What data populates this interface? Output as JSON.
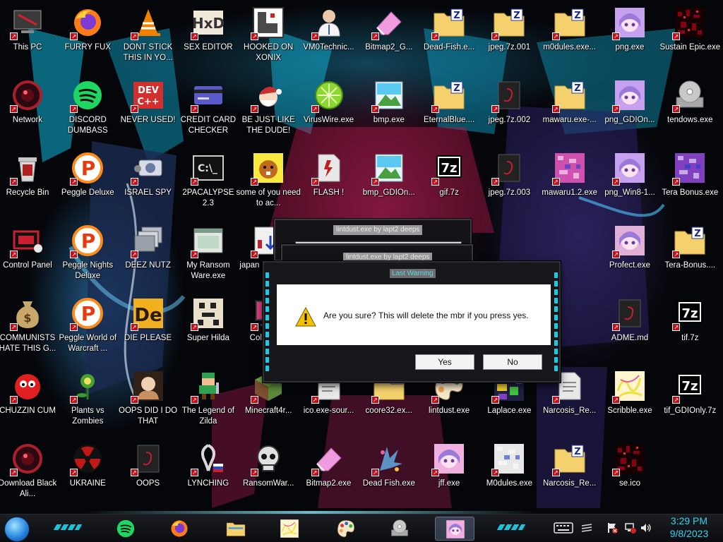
{
  "desktop": {
    "icons": [
      {
        "label": "This PC",
        "icon": "computer-icon",
        "color": "#3a3a3a"
      },
      {
        "label": "FURRY FUX",
        "icon": "firefox-icon",
        "color": "#ff7b16"
      },
      {
        "label": "DONT STICK THIS IN YO...",
        "icon": "vlc-cone-icon",
        "color": "#f08000"
      },
      {
        "label": "SEX EDITOR",
        "icon": "hxd-editor-icon",
        "color": "#f0e8d8"
      },
      {
        "label": "HOOKED ON XONIX",
        "icon": "xonix-game-icon",
        "color": "#4a4a4a"
      },
      {
        "label": "VM0Technic...",
        "icon": "doctor-person-icon",
        "color": "#e8c8a8"
      },
      {
        "label": "Bitmap2_G...",
        "icon": "eraser-icon",
        "color": "#f09ae0"
      },
      {
        "label": "Dead-Fish.e...",
        "icon": "zip-folder-icon",
        "color": "#f5d16e"
      },
      {
        "label": "jpeg.7z.001",
        "icon": "zip-folder-icon",
        "color": "#f5d16e"
      },
      {
        "label": "m0dules.exe...",
        "icon": "zip-folder-icon",
        "color": "#f5d16e"
      },
      {
        "label": "png.exe",
        "icon": "anime-girl-icon",
        "color": "#c8a0f0"
      },
      {
        "label": "Sustain Epic.exe",
        "icon": "noise-red-icon",
        "color": "#8a0010"
      },
      {
        "label": "Network",
        "icon": "network-orb-icon",
        "color": "#aa1e2e"
      },
      {
        "label": "DISCORD DUMBASS",
        "icon": "spotify-icon",
        "color": "#1ed760"
      },
      {
        "label": "NEVER USED!",
        "icon": "devcpp-icon",
        "color": "#d32f2f"
      },
      {
        "label": "CREDIT CARD CHECKER",
        "icon": "credit-card-icon",
        "color": "#5a5ac8"
      },
      {
        "label": "BE JUST LIKE THE DUDE!",
        "icon": "santa-icon",
        "color": "#c83030"
      },
      {
        "label": "VirusWire.exe",
        "icon": "lime-icon",
        "color": "#8ad830"
      },
      {
        "label": "bmp.exe",
        "icon": "image-file-icon",
        "color": "#5ac8f0"
      },
      {
        "label": "EternalBlue....",
        "icon": "zip-folder-icon",
        "color": "#f5d16e"
      },
      {
        "label": "jpeg.7z.002",
        "icon": "dark-file-icon",
        "color": "#222222"
      },
      {
        "label": "mawaru.exe-...",
        "icon": "zip-folder-icon",
        "color": "#f5d16e"
      },
      {
        "label": "png_GDIOn...",
        "icon": "anime-girl-icon",
        "color": "#c8a0f0"
      },
      {
        "label": "tendows.exe",
        "icon": "cd-drive-icon",
        "color": "#c8c8c8"
      },
      {
        "label": "Recycle Bin",
        "icon": "recycle-bin-icon",
        "color": "#b02020"
      },
      {
        "label": "Peggle Deluxe",
        "icon": "peggle-icon",
        "color": "#ff8c1a"
      },
      {
        "label": "ISRAEL SPY",
        "icon": "camera-icon",
        "color": "#d8dce8"
      },
      {
        "label": "2PACALYPSE 2.3",
        "icon": "terminal-icon",
        "color": "#111111"
      },
      {
        "label": "some of you need to ac...",
        "icon": "dog-icon",
        "color": "#c06a1e"
      },
      {
        "label": "FLASH !",
        "icon": "flash-file-icon",
        "color": "#e8e8e8"
      },
      {
        "label": "bmp_GDIOn...",
        "icon": "image-file-icon",
        "color": "#5ac8f0"
      },
      {
        "label": "gif.7z",
        "icon": "7z-icon",
        "color": "#ffffff"
      },
      {
        "label": "jpeg.7z.003",
        "icon": "dark-file-icon",
        "color": "#222222"
      },
      {
        "label": "mawaru1.2.exe",
        "icon": "pixel-noise-icon",
        "color": "#d050b0"
      },
      {
        "label": "png_Win8-1...",
        "icon": "anime-girl-icon",
        "color": "#c8a0f0"
      },
      {
        "label": "Tera Bonus.exe",
        "icon": "pixel-noise-icon",
        "color": "#8040c0"
      },
      {
        "label": "Control Panel",
        "icon": "control-panel-icon",
        "color": "#c82030"
      },
      {
        "label": "Peggle Nights Deluxe",
        "icon": "peggle-icon",
        "color": "#ff8c1a"
      },
      {
        "label": "DEEZ NUTZ",
        "icon": "window-stack-icon",
        "color": "#9aa0aa"
      },
      {
        "label": "My Ransom Ware.exe",
        "icon": "app-window-icon",
        "color": "#e0e8e0"
      },
      {
        "label": "japan suicid sim",
        "icon": "installer-icon",
        "color": "#f0f0f0"
      },
      {
        "label": "Profect.exe",
        "icon": "anime-girl-icon",
        "color": "#e0b0d8"
      },
      {
        "label": "Tera-Bonus....",
        "icon": "zip-folder-icon",
        "color": "#f5d16e"
      },
      {
        "label": "COMMUNISTS HATE THIS G...",
        "icon": "money-bag-icon",
        "color": "#c8a868"
      },
      {
        "label": "Peggle World of Warcraft ...",
        "icon": "peggle-icon",
        "color": "#ff8c1a"
      },
      {
        "label": "DIE PLEASE",
        "icon": "de-icon",
        "color": "#f0b020"
      },
      {
        "label": "Super Hilda",
        "icon": "pixel-sprite-icon",
        "color": "#e8e0c8"
      },
      {
        "label": "CollabVMt",
        "icon": "monitor-icon",
        "color": "#e04080"
      },
      {
        "label": "ADME.md",
        "icon": "dark-file-icon",
        "color": "#222222"
      },
      {
        "label": "tif.7z",
        "icon": "7z-icon",
        "color": "#ffffff"
      },
      {
        "label": "CHUZZIN CUM",
        "icon": "chuzzle-icon",
        "color": "#e02020"
      },
      {
        "label": "Plants vs Zombies",
        "icon": "plant-icon",
        "color": "#4aa030"
      },
      {
        "label": "OOPS DID I DO THAT",
        "icon": "portrait-icon",
        "color": "#c89060"
      },
      {
        "label": "The Legend of Zilda",
        "icon": "pixel-hero-icon",
        "color": "#30a050"
      },
      {
        "label": "Minecraft4r...",
        "icon": "grass-block-icon",
        "color": "#5a8a3a"
      },
      {
        "label": "ico.exe-sour...",
        "icon": "script-file-icon",
        "color": "#e8e8e8"
      },
      {
        "label": "coore32.ex...",
        "icon": "zip-folder-icon",
        "color": "#f5d16e"
      },
      {
        "label": "lintdust.exe",
        "icon": "paint-palette-icon",
        "color": "#f0a050"
      },
      {
        "label": "Laplace.exe",
        "icon": "noise-color-icon",
        "color": "#40c040"
      },
      {
        "label": "Narcosis_Re...",
        "icon": "script-file-icon",
        "color": "#e8e8e8"
      },
      {
        "label": "Scribble.exe",
        "icon": "scribble-icon",
        "color": "#f0e040"
      },
      {
        "label": "tif_GDIOnly.7z",
        "icon": "7z-icon",
        "color": "#ffffff"
      },
      {
        "label": "Download Black Ali...",
        "icon": "network-orb-icon",
        "color": "#aa1e2e"
      },
      {
        "label": "UKRAINE",
        "icon": "radiation-icon",
        "color": "#c01818"
      },
      {
        "label": "OOPS",
        "icon": "dark-file-icon",
        "color": "#222222"
      },
      {
        "label": "LYNCHING",
        "icon": "knot-flag-icon",
        "color": "#d8d8d8"
      },
      {
        "label": "RansomWar...",
        "icon": "skull-icon",
        "color": "#e0e0e0"
      },
      {
        "label": "Bitmap2.exe",
        "icon": "eraser-icon",
        "color": "#f09ae0"
      },
      {
        "label": "Dead Fish.exe",
        "icon": "paint-splash-icon",
        "color": "#60a8e0"
      },
      {
        "label": "jff.exe",
        "icon": "anime-girl-icon",
        "color": "#f0b0e0"
      },
      {
        "label": "M0dules.exe",
        "icon": "pixel-noise-icon",
        "color": "#e8e8e8"
      },
      {
        "label": "Narcosis_Re...",
        "icon": "zip-folder-icon",
        "color": "#f5d16e"
      },
      {
        "label": "se.ico",
        "icon": "noise-red-icon",
        "color": "#8a0010"
      }
    ]
  },
  "dialogs": {
    "back1_title": "lintdust.exe by lapt2 deeps",
    "back2_title": "lintdust.exe by lapt2 deeps",
    "main": {
      "title": "Last Warning",
      "message": "Are you sure? This will delete the mbr if you press yes.",
      "yes_label": "Yes",
      "no_label": "No"
    }
  },
  "taskbar": {
    "pinned": [
      {
        "icon": "spotify-icon",
        "color": "#1ed760"
      },
      {
        "icon": "firefox-icon",
        "color": "#ff7b16"
      },
      {
        "icon": "file-explorer-icon",
        "color": "#f5d16e"
      },
      {
        "icon": "scribble-icon",
        "color": "#f0e040"
      },
      {
        "icon": "paint-palette-icon",
        "color": "#f0a050"
      },
      {
        "icon": "cd-drive-icon",
        "color": "#c8c8c8"
      },
      {
        "icon": "anime-girl-icon",
        "color": "#f0b0e0"
      }
    ],
    "clock_time": "3:29 PM",
    "clock_date": "9/8/2023"
  },
  "colors": {
    "accent": "#2fd4ef",
    "dialog_frame": "#17171b"
  }
}
